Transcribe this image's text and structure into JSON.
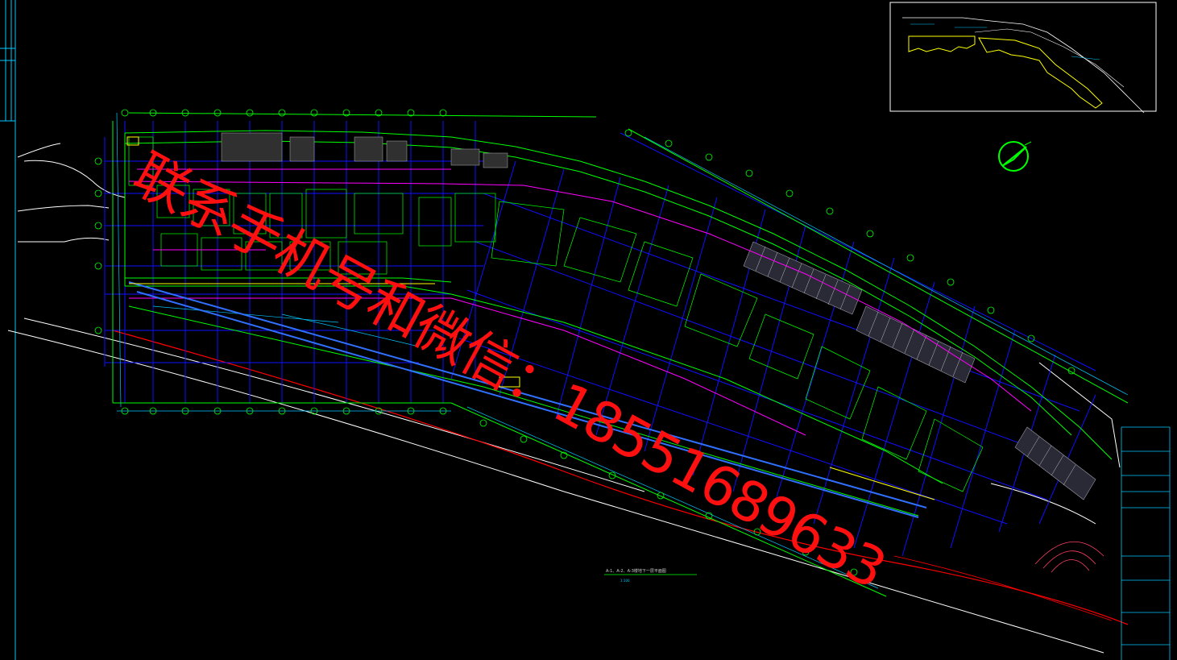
{
  "watermark": {
    "text": "联系手机号和微信：18551689633",
    "color": "#ff1010"
  },
  "drawing_title": "A-1、A-2、A-3楼地下一层平面图",
  "drawing_scale": "1:100",
  "colors": {
    "background": "#000000",
    "axis_lines": "#0000ff",
    "walls": "#00ff00",
    "dimensions": "#00c8ff",
    "property_line": "#ff0000",
    "boundary": "#ff00ff",
    "road": "#ffffff",
    "highlight": "#ffff00"
  },
  "icons": [
    "north-arrow-icon"
  ]
}
